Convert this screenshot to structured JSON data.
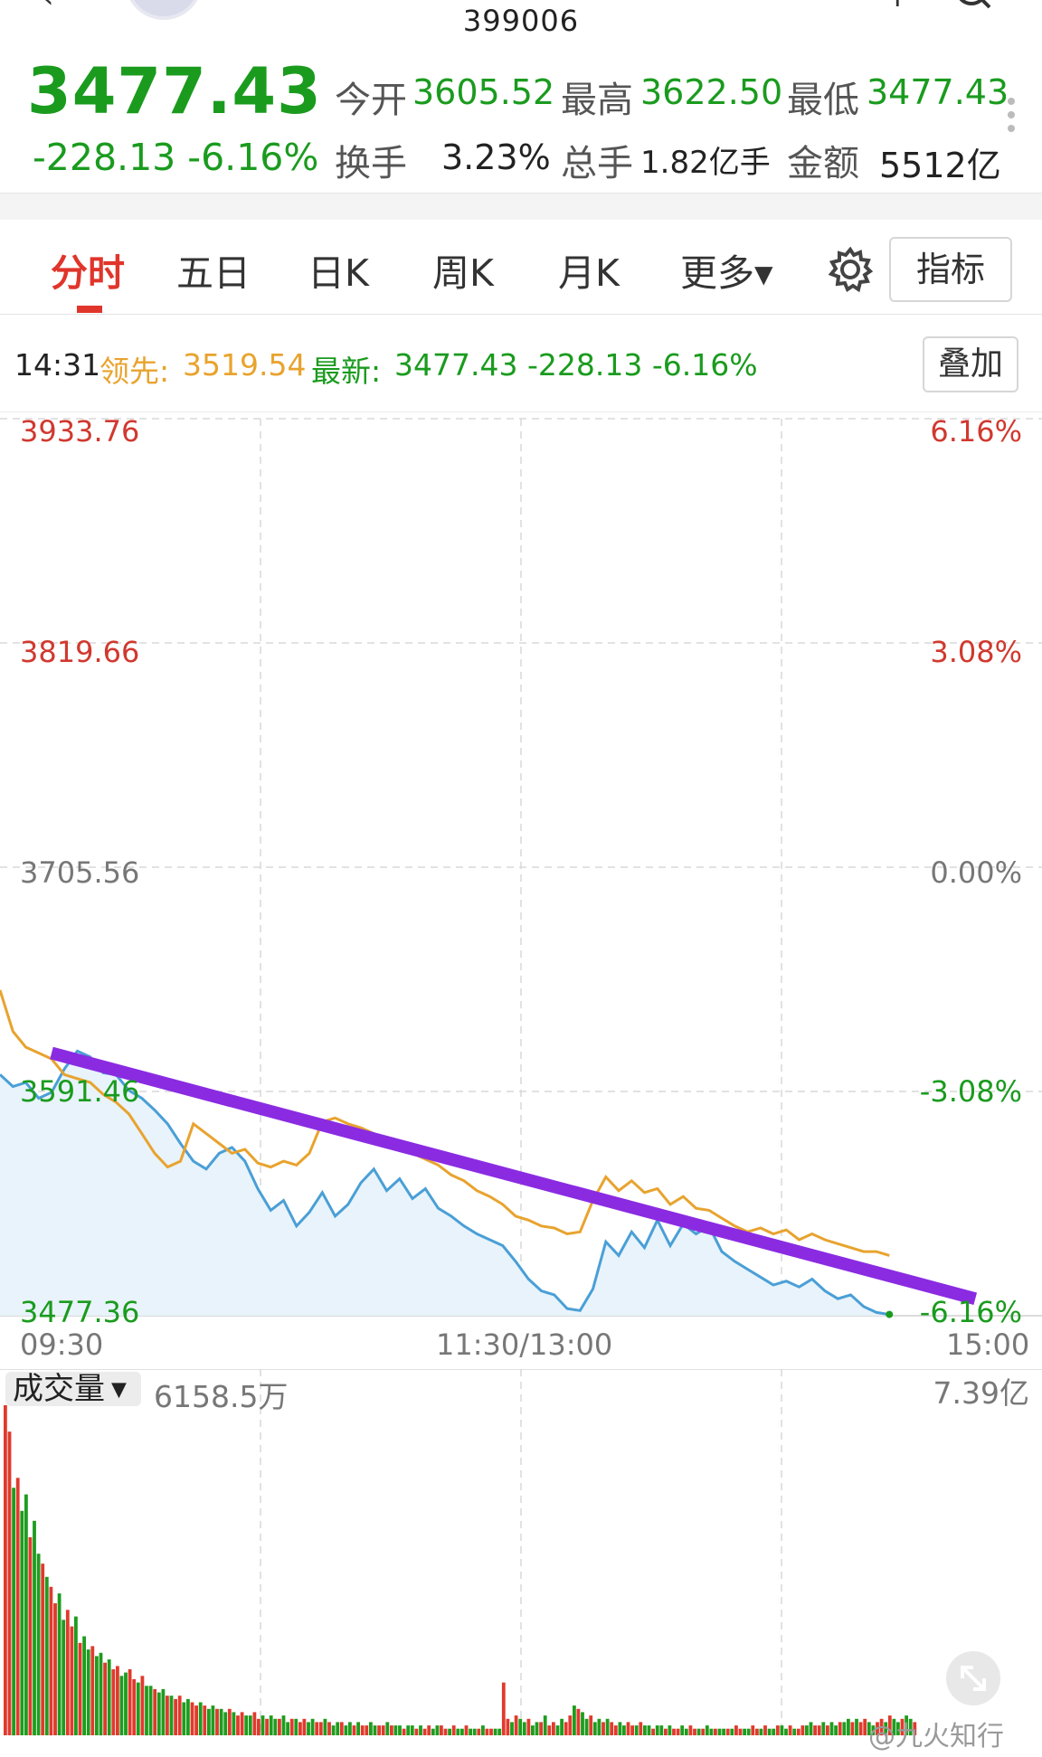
{
  "header": {
    "code": "399006"
  },
  "quote": {
    "price": "3477.43",
    "change": "-228.13 -6.16%",
    "open_label": "今开",
    "open": "3605.52",
    "high_label": "最高",
    "high": "3622.50",
    "low_label": "最低",
    "low": "3477.43",
    "turnover_label": "换手",
    "turnover": "3.23%",
    "volume_label": "总手",
    "volume": "1.82亿手",
    "amount_label": "金额",
    "amount": "5512亿"
  },
  "tabs": {
    "items": [
      "分时",
      "五日",
      "日K",
      "周K",
      "月K",
      "更多▾"
    ],
    "active": "分时",
    "indicator_button": "指标",
    "overlay_button": "叠加"
  },
  "info_line": {
    "time": "14:31",
    "lead_label": "领先:",
    "lead_value": "3519.54",
    "latest_label": "最新:",
    "latest_value": "3477.43 -228.13 -6.16%"
  },
  "chart_data": {
    "type": "line",
    "y_left_ticks": [
      "3933.76",
      "3819.66",
      "3705.56",
      "3591.46",
      "3477.36"
    ],
    "y_right_ticks": [
      "6.16%",
      "3.08%",
      "0.00%",
      "-3.08%",
      "-6.16%"
    ],
    "x_ticks": [
      "09:30",
      "11:30/13:00",
      "15:00"
    ],
    "ylim": [
      3477.36,
      3933.76
    ],
    "x_minutes_total": 240,
    "series": [
      {
        "color": "#4a9fd6",
        "values": [
          [
            0,
            3600
          ],
          [
            3,
            3594
          ],
          [
            6,
            3596
          ],
          [
            9,
            3588
          ],
          [
            12,
            3591
          ],
          [
            15,
            3603
          ],
          [
            18,
            3612
          ],
          [
            21,
            3609
          ],
          [
            24,
            3601
          ],
          [
            27,
            3600
          ],
          [
            30,
            3592
          ],
          [
            33,
            3588
          ],
          [
            36,
            3582
          ],
          [
            39,
            3575
          ],
          [
            42,
            3565
          ],
          [
            45,
            3556
          ],
          [
            48,
            3552
          ],
          [
            51,
            3560
          ],
          [
            54,
            3563
          ],
          [
            57,
            3556
          ],
          [
            60,
            3542
          ],
          [
            63,
            3531
          ],
          [
            66,
            3536
          ],
          [
            69,
            3523
          ],
          [
            72,
            3530
          ],
          [
            75,
            3540
          ],
          [
            78,
            3528
          ],
          [
            81,
            3534
          ],
          [
            84,
            3545
          ],
          [
            87,
            3552
          ],
          [
            90,
            3541
          ],
          [
            93,
            3547
          ],
          [
            96,
            3537
          ],
          [
            99,
            3542
          ],
          [
            102,
            3532
          ],
          [
            105,
            3528
          ],
          [
            108,
            3523
          ],
          [
            111,
            3519
          ],
          [
            114,
            3516
          ],
          [
            117,
            3513
          ],
          [
            120,
            3505
          ],
          [
            123,
            3496
          ],
          [
            126,
            3490
          ],
          [
            129,
            3488
          ],
          [
            132,
            3481
          ],
          [
            135,
            3480
          ],
          [
            138,
            3491
          ],
          [
            141,
            3515
          ],
          [
            144,
            3508
          ],
          [
            147,
            3520
          ],
          [
            150,
            3512
          ],
          [
            153,
            3526
          ],
          [
            156,
            3513
          ],
          [
            159,
            3524
          ],
          [
            162,
            3519
          ],
          [
            165,
            3523
          ],
          [
            168,
            3510
          ],
          [
            171,
            3505
          ],
          [
            174,
            3501
          ],
          [
            177,
            3497
          ],
          [
            180,
            3493
          ],
          [
            183,
            3495
          ],
          [
            186,
            3492
          ],
          [
            189,
            3496
          ],
          [
            192,
            3490
          ],
          [
            195,
            3486
          ],
          [
            198,
            3488
          ],
          [
            201,
            3482
          ],
          [
            204,
            3479
          ],
          [
            207,
            3478
          ]
        ]
      },
      {
        "color": "#e8a32e",
        "values": [
          [
            0,
            3643
          ],
          [
            3,
            3622
          ],
          [
            6,
            3614
          ],
          [
            9,
            3611
          ],
          [
            12,
            3608
          ],
          [
            15,
            3600
          ],
          [
            18,
            3598
          ],
          [
            21,
            3596
          ],
          [
            24,
            3590
          ],
          [
            27,
            3586
          ],
          [
            30,
            3580
          ],
          [
            33,
            3570
          ],
          [
            36,
            3560
          ],
          [
            39,
            3553
          ],
          [
            42,
            3556
          ],
          [
            45,
            3575
          ],
          [
            48,
            3570
          ],
          [
            51,
            3565
          ],
          [
            54,
            3560
          ],
          [
            57,
            3562
          ],
          [
            60,
            3555
          ],
          [
            63,
            3553
          ],
          [
            66,
            3556
          ],
          [
            69,
            3554
          ],
          [
            72,
            3560
          ],
          [
            75,
            3576
          ],
          [
            78,
            3578
          ],
          [
            81,
            3575
          ],
          [
            84,
            3573
          ],
          [
            87,
            3570
          ],
          [
            90,
            3566
          ],
          [
            93,
            3563
          ],
          [
            96,
            3560
          ],
          [
            99,
            3557
          ],
          [
            102,
            3554
          ],
          [
            105,
            3549
          ],
          [
            108,
            3546
          ],
          [
            111,
            3541
          ],
          [
            114,
            3538
          ],
          [
            117,
            3534
          ],
          [
            120,
            3528
          ],
          [
            123,
            3526
          ],
          [
            126,
            3523
          ],
          [
            129,
            3522
          ],
          [
            132,
            3519
          ],
          [
            135,
            3520
          ],
          [
            138,
            3536
          ],
          [
            141,
            3548
          ],
          [
            144,
            3541
          ],
          [
            147,
            3546
          ],
          [
            150,
            3540
          ],
          [
            153,
            3542
          ],
          [
            156,
            3534
          ],
          [
            159,
            3538
          ],
          [
            162,
            3532
          ],
          [
            165,
            3531
          ],
          [
            168,
            3527
          ],
          [
            171,
            3523
          ],
          [
            174,
            3520
          ],
          [
            177,
            3522
          ],
          [
            180,
            3519
          ],
          [
            183,
            3521
          ],
          [
            186,
            3516
          ],
          [
            189,
            3519
          ],
          [
            192,
            3516
          ],
          [
            195,
            3514
          ],
          [
            198,
            3512
          ],
          [
            201,
            3510
          ],
          [
            204,
            3510
          ],
          [
            207,
            3508
          ]
        ]
      }
    ],
    "trend_line": {
      "color": "#8a2be2",
      "from": [
        12,
        3611
      ],
      "to": [
        227,
        3486
      ]
    },
    "volume": {
      "label": "成交量",
      "current": "6158.5万",
      "max_label": "7.39亿",
      "bars": [
        100,
        92,
        75,
        78,
        68,
        73,
        60,
        65,
        55,
        52,
        48,
        45,
        40,
        43,
        35,
        38,
        33,
        36,
        28,
        30,
        26,
        27,
        24,
        25,
        22,
        23,
        20,
        21,
        18,
        19,
        20,
        17,
        16,
        18,
        15,
        15,
        14,
        13,
        14,
        12,
        12,
        11,
        12,
        10,
        11,
        10,
        9,
        10,
        9,
        8,
        9,
        8,
        8,
        7,
        8,
        7,
        6,
        7,
        6,
        6,
        7,
        5,
        6,
        5,
        6,
        5,
        5,
        6,
        4,
        5,
        5,
        4,
        5,
        4,
        5,
        4,
        4,
        5,
        4,
        3,
        4,
        4,
        3,
        4,
        3,
        4,
        3,
        3,
        4,
        3,
        3,
        3,
        4,
        3,
        3,
        3,
        2,
        3,
        3,
        2,
        3,
        2,
        3,
        2,
        3,
        3,
        2,
        2,
        3,
        2,
        2,
        3,
        2,
        2,
        2,
        3,
        2,
        2,
        2,
        2,
        16,
        5,
        4,
        6,
        5,
        4,
        5,
        3,
        4,
        4,
        6,
        3,
        4,
        3,
        5,
        4,
        6,
        9,
        8,
        7,
        5,
        6,
        4,
        5,
        4,
        5,
        4,
        3,
        4,
        3,
        4,
        3,
        3,
        4,
        3,
        3,
        2,
        3,
        3,
        2,
        3,
        2,
        2,
        3,
        2,
        3,
        2,
        2,
        2,
        3,
        2,
        2,
        2,
        2,
        2,
        2,
        3,
        2,
        2,
        2,
        3,
        2,
        2,
        3,
        2,
        2,
        3,
        3,
        2,
        3,
        2,
        2,
        3,
        3,
        4,
        3,
        3,
        4,
        3,
        4,
        3,
        4,
        4,
        5,
        4,
        5,
        4,
        5,
        4,
        3,
        4,
        5,
        4,
        6,
        5,
        4,
        5,
        6,
        5,
        4
      ],
      "bar_colors": [
        "#1e9c1e",
        "#e03a2d"
      ]
    },
    "grid": true
  },
  "watermark": "@九火知行"
}
